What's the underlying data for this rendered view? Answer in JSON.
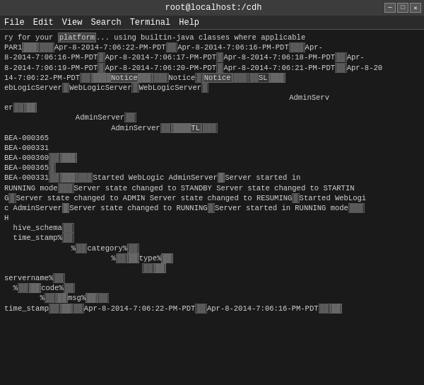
{
  "window": {
    "title": "root@localhost:/cdh",
    "buttons": {
      "minimize": "─",
      "maximize": "□",
      "close": "✕"
    }
  },
  "menu": {
    "items": [
      "File",
      "Edit",
      "View",
      "Search",
      "Terminal",
      "Help"
    ]
  },
  "terminal": {
    "lines": [
      "ry for your platform... using builtin-java classes where applicable",
      "PAR1[BLOCKS]Apr-8-2014-7:06:22-PM-PDT[BLOCKS]Apr-8-2014-7:06:16-PM-PDT[BLOCKS]Apr-",
      "8-2014-7:06:16-PM-PDT[BLOCKS]Apr-8-2014-7:06:17-PM-PDT[BLOCKS]Apr-8-2014-7:06:18-PM-PDT[BLOCKS]Apr-",
      "8-2014-7:06:19-PM-PDT[BLOCKS]Apr-8-2014-7:06:20-PM-PDT[BLOCKS]Apr-8-2014-7:06:21-PM-PDT[BLOCKS]Apr-8-20",
      "14-7:06:22-PM-PDT[BLOCKS][BLOCKS]Notice[BLOCKS][BLOCKS]Notice[BLOCKS]Notice[BLOCKS][BLOCKS]SL[BLOCKS]",
      "ebLogicServer[BLOCKS]WebLogicServer[BLOCKS]WebLogicServer[BLOCKS]",
      "                                                                AdminServ",
      "er[BLOCKS][BLOCKS]",
      "                AdminServer[BLOCKS]",
      "                        AdminServer[BLOCKS][BLOCKS][BLOCKS]TL[BLOCKS]",
      "BEA-000365",
      "BEA-000331",
      "BEA-000360[BLOCKS][BLOCKS]",
      "BEA-000365[BLOCKS]",
      "BEA-000331[BLOCKS][BLOCKS][BLOCKS][BLOCKS]Started WebLogic AdminServer[BLOCKS]Server started in",
      "RUNNING mode[BLOCKS]Server state changed to STANDBY Server state changed to STARTIN",
      "G[BLOCKS]Server state changed to ADMIN Server state changed to RESUMING[BLOCKS]Started WebLogi",
      "c AdminServer[BLOCKS]Server state changed to RUNNING[BLOCKS]Server started in RUNNING mode[BLOCKS]",
      "H",
      "  hive_schema[BLOCKS]",
      "",
      "  time_stamp%[BLOCKS]",
      "               %[BLOCKS]category%[BLOCKS]",
      "                        %[BLOCKS][BLOCKS]type%[BLOCKS]",
      "                               [BLOCKS][BLOCKS]",
      "servername%[BLOCKS]",
      "  %[BLOCKS][BLOCKS]code%[BLOCKS]",
      "        %[BLOCKS][BLOCKS]msg%[BLOCKS][BLOCKS]",
      "",
      "time_stamp[BLOCKS][BLOCKS][BLOCKS]Apr-8-2014-7:06:22-PM-PDT[BLOCKS]Apr-8-2014-7:06:16-PM-PDT[BLOCKS][BLOCKS]"
    ]
  }
}
